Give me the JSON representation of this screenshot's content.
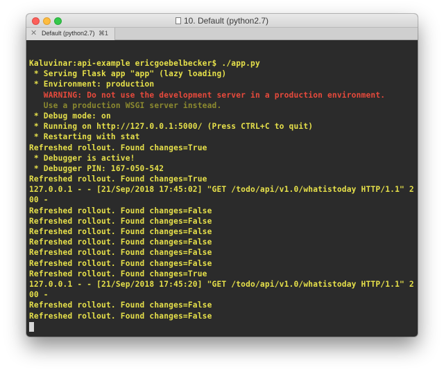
{
  "window": {
    "title": "10. Default (python2.7)"
  },
  "tab": {
    "label": "Default (python2.7)",
    "shortcut": "⌘1",
    "close_glyph": "✕"
  },
  "terminal": {
    "lines": [
      {
        "text": "Kaluvinar:api-example ericgoebelbecker$ ./app.py",
        "style": "normal"
      },
      {
        "text": " * Serving Flask app \"app\" (lazy loading)",
        "style": "normal"
      },
      {
        "text": " * Environment: production",
        "style": "normal"
      },
      {
        "text": "   WARNING: Do not use the development server in a production environment.",
        "style": "warning"
      },
      {
        "text": "   Use a production WSGI server instead.",
        "style": "muted"
      },
      {
        "text": " * Debug mode: on",
        "style": "normal"
      },
      {
        "text": " * Running on http://127.0.0.1:5000/ (Press CTRL+C to quit)",
        "style": "normal"
      },
      {
        "text": " * Restarting with stat",
        "style": "normal"
      },
      {
        "text": "Refreshed rollout. Found changes=True",
        "style": "normal"
      },
      {
        "text": " * Debugger is active!",
        "style": "normal"
      },
      {
        "text": " * Debugger PIN: 167-050-542",
        "style": "normal"
      },
      {
        "text": "Refreshed rollout. Found changes=True",
        "style": "normal"
      },
      {
        "text": "127.0.0.1 - - [21/Sep/2018 17:45:02] \"GET /todo/api/v1.0/whatistoday HTTP/1.1\" 2",
        "style": "normal"
      },
      {
        "text": "00 -",
        "style": "normal"
      },
      {
        "text": "Refreshed rollout. Found changes=False",
        "style": "normal"
      },
      {
        "text": "Refreshed rollout. Found changes=False",
        "style": "normal"
      },
      {
        "text": "Refreshed rollout. Found changes=False",
        "style": "normal"
      },
      {
        "text": "Refreshed rollout. Found changes=False",
        "style": "normal"
      },
      {
        "text": "Refreshed rollout. Found changes=False",
        "style": "normal"
      },
      {
        "text": "Refreshed rollout. Found changes=False",
        "style": "normal"
      },
      {
        "text": "Refreshed rollout. Found changes=True",
        "style": "normal"
      },
      {
        "text": "127.0.0.1 - - [21/Sep/2018 17:45:20] \"GET /todo/api/v1.0/whatistoday HTTP/1.1\" 2",
        "style": "normal"
      },
      {
        "text": "00 -",
        "style": "normal"
      },
      {
        "text": "Refreshed rollout. Found changes=False",
        "style": "normal"
      },
      {
        "text": "Refreshed rollout. Found changes=False",
        "style": "normal"
      }
    ]
  },
  "colors": {
    "terminal_background": "#2b2b2b",
    "output_text": "#e6e04a",
    "warning_text": "#e84a3c",
    "muted_text": "#8c8a2f",
    "cursor": "#d8d8d8"
  },
  "icons": {
    "title_icon": "document-icon",
    "tab_close_icon": "close-icon"
  }
}
